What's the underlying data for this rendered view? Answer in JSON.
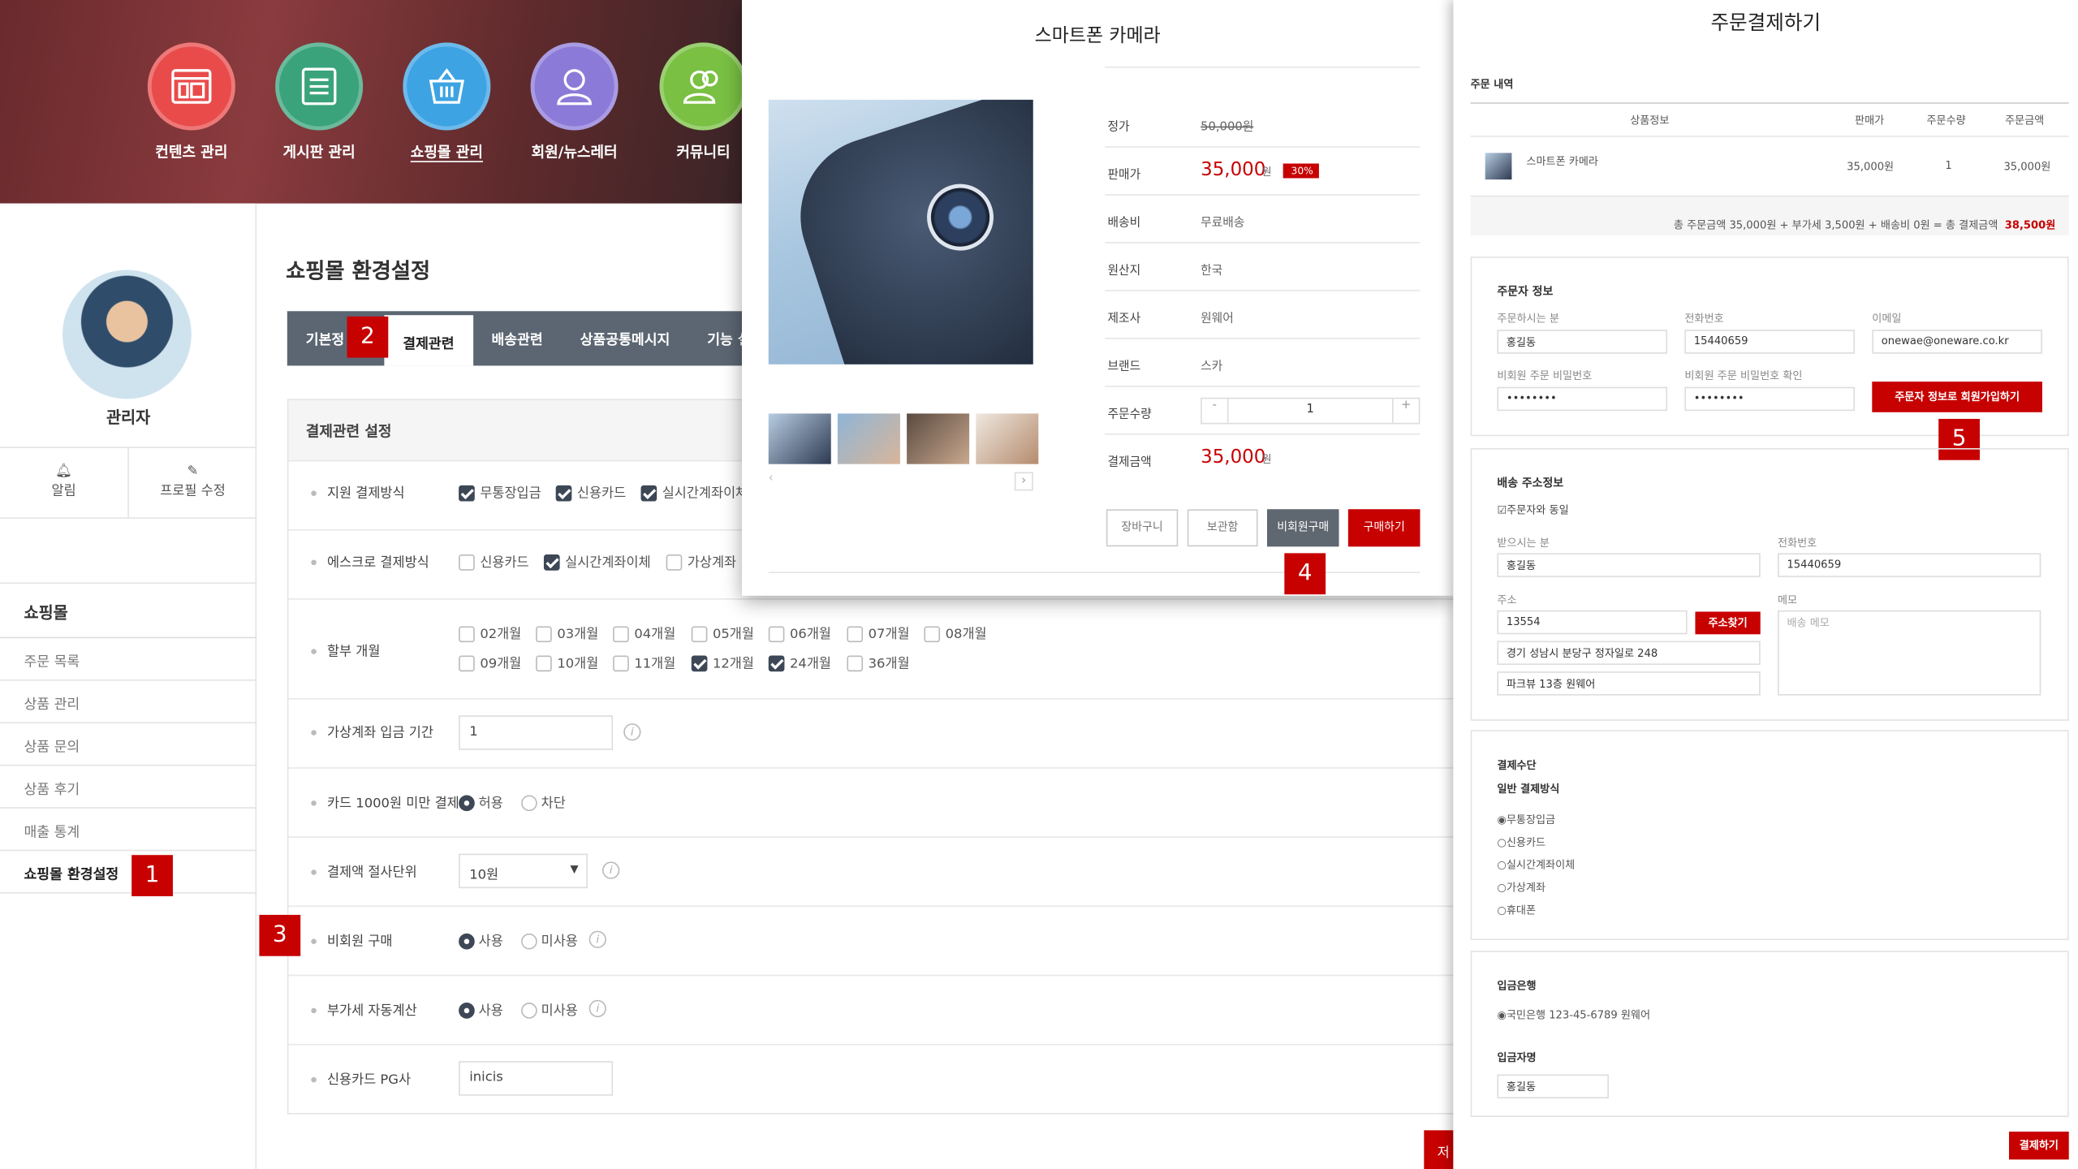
{
  "top_nav": [
    {
      "label": "컨텐츠 관리",
      "color": "#e94b4b",
      "icon": "layout-icon"
    },
    {
      "label": "게시판 관리",
      "color": "#3aa37c",
      "icon": "list-icon"
    },
    {
      "label": "쇼핑몰 관리",
      "color": "#3da3e3",
      "icon": "basket-icon"
    },
    {
      "label": "회원/뉴스레터",
      "color": "#8c7ad9",
      "icon": "user-icon"
    },
    {
      "label": "커뮤니티",
      "color": "#79c043",
      "icon": "users-icon"
    }
  ],
  "sidebar": {
    "admin_name": "관리자",
    "alarm": "알림",
    "profile_edit": "프로필 수정",
    "section_title": "쇼핑몰",
    "items": [
      "주문 목록",
      "상품 관리",
      "상품 문의",
      "상품 후기",
      "매출 통계",
      "쇼핑몰 환경설정"
    ]
  },
  "main": {
    "page_title": "쇼핑몰 환경설정",
    "tabs": [
      "기본정",
      "결제관련",
      "배송관련",
      "상품공통메시지",
      "기능 설정"
    ],
    "section_title": "결제관련 설정",
    "rows": {
      "pay_methods": {
        "label": "지원 결제방식",
        "options": [
          "무통장입금",
          "신용카드",
          "실시간계좌이체"
        ]
      },
      "escrow": {
        "label": "에스크로 결제방식",
        "options": [
          "신용카드",
          "실시간계좌이체",
          "가상계좌"
        ]
      },
      "installment": {
        "label": "할부 개월",
        "months": [
          "02개월",
          "03개월",
          "04개월",
          "05개월",
          "06개월",
          "07개월",
          "08개월",
          "09개월",
          "10개월",
          "11개월",
          "12개월",
          "24개월",
          "36개월"
        ]
      },
      "vbank_period": {
        "label": "가상계좌 입금 기간",
        "value": "1"
      },
      "card_under": {
        "label": "카드 1000원 미만 결제",
        "allow": "허용",
        "block": "차단"
      },
      "rounding": {
        "label": "결제액 절사단위",
        "value": "10원"
      },
      "guest": {
        "label": "비회원 구매",
        "use": "사용",
        "nouse": "미사용"
      },
      "vat": {
        "label": "부가세 자동계산",
        "use": "사용",
        "nouse": "미사용"
      },
      "pg": {
        "label": "신용카드 PG사",
        "value": "inicis"
      }
    },
    "save": "저"
  },
  "badges": [
    "1",
    "2",
    "3",
    "4",
    "5"
  ],
  "product": {
    "title": "스마트폰 카메라",
    "rows": [
      {
        "k": "정가",
        "v": "50,000원"
      },
      {
        "k": "판매가",
        "v": "35,000",
        "unit": "원",
        "sale": "30%"
      },
      {
        "k": "배송비",
        "v": "무료배송"
      },
      {
        "k": "원산지",
        "v": "한국"
      },
      {
        "k": "제조사",
        "v": "원웨어"
      },
      {
        "k": "브랜드",
        "v": "스카"
      },
      {
        "k": "주문수량",
        "v": "1",
        "minus": "-",
        "plus": "+"
      },
      {
        "k": "결제금액",
        "v": "35,000",
        "unit": "원"
      }
    ],
    "buttons": {
      "cart": "장바구니",
      "wish": "보관함",
      "guest": "비회원구매",
      "buy": "구매하기"
    }
  },
  "order": {
    "title": "주문결제하기",
    "list_title": "주문 내역",
    "headers": [
      "상품정보",
      "판매가",
      "주문수량",
      "주문금액"
    ],
    "item": {
      "name": "스마트폰 카메라",
      "price": "35,000원",
      "qty": "1",
      "amount": "35,000원"
    },
    "summary": "총 주문금액 35,000원 + 부가세 3,500원 + 배송비 0원 = 총 결제금액",
    "total": "38,500원",
    "orderer": {
      "title": "주문자 정보",
      "name_lbl": "주문하시는 분",
      "name": "홍길동",
      "phone_lbl": "전화번호",
      "phone": "15440659",
      "email_lbl": "이메일",
      "email": "onewae@oneware.co.kr",
      "pw_lbl": "비회원 주문 비밀번호",
      "pw": "••••••••",
      "pw2_lbl": "비회원 주문 비밀번호 확인",
      "pw2": "••••••••",
      "join": "주문자 정보로 회원가입하기"
    },
    "ship": {
      "title": "배송 주소정보",
      "same": "주문자와 동일",
      "recv_lbl": "받으시는 분",
      "recv": "홍길동",
      "phone_lbl": "전화번호",
      "phone": "15440659",
      "addr_lbl": "주소",
      "zip": "13554",
      "find": "주소찾기",
      "addr1": "경기 성남시 분당구 정자일로 248",
      "addr2": "파크뷰 13층 원웨어",
      "memo_lbl": "메모",
      "memo_ph": "배송 메모"
    },
    "pay": {
      "title": "결제수단",
      "sub": "일반 결제방식",
      "methods": [
        "무통장입금",
        "신용카드",
        "실시간계좌이체",
        "가상계좌",
        "휴대폰"
      ]
    },
    "bank": {
      "title": "입금은행",
      "account": "국민은행 123-45-6789 원웨어",
      "depositor_lbl": "입금자명",
      "depositor": "홍길동"
    },
    "submit": "결제하기"
  }
}
